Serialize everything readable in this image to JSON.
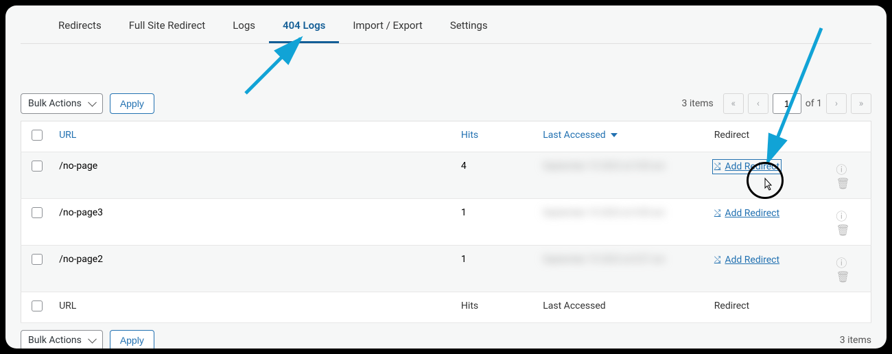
{
  "tabs": {
    "redirects": "Redirects",
    "full_site": "Full Site Redirect",
    "logs": "Logs",
    "logs404": "404 Logs",
    "import_export": "Import / Export",
    "settings": "Settings"
  },
  "bulk": {
    "label": "Bulk Actions",
    "apply": "Apply"
  },
  "pager": {
    "count": "3 items",
    "first": "«",
    "prev": "‹",
    "current": "1",
    "of": "of 1",
    "next": "›",
    "last": "»"
  },
  "headers": {
    "url": "URL",
    "hits": "Hits",
    "last": "Last Accessed",
    "redirect": "Redirect"
  },
  "rows": [
    {
      "url": "/no-page",
      "hits": "4",
      "last": "September 10 2023 at 9:00 am",
      "add": "Add Redirect"
    },
    {
      "url": "/no-page3",
      "hits": "1",
      "last": "September 10 2023 at 9:00 am",
      "add": "Add Redirect"
    },
    {
      "url": "/no-page2",
      "hits": "1",
      "last": "September 10 2023 at 8:57 am",
      "add": "Add Redirect"
    }
  ],
  "icons": {
    "shuffle": "✕",
    "info": "ⓘ",
    "trash": "🗑"
  }
}
